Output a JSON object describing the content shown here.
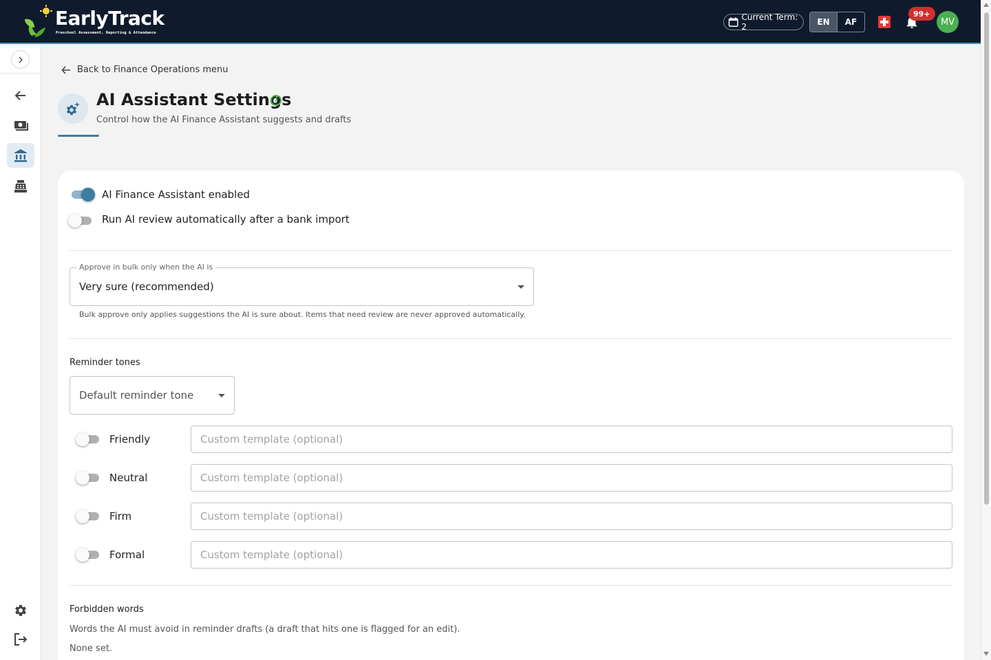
{
  "app": {
    "name": "EarlyTrack",
    "tagline": "Preschool Assessment, Reporting & Attendance"
  },
  "topbar": {
    "term_label": "Current Term: 2",
    "languages": [
      "EN",
      "AF"
    ],
    "active_language": "EN",
    "notification_count": "99+",
    "user_initials": "MV",
    "colors": {
      "bar": "#0f1b2d",
      "badge": "#d32f2f",
      "avatar": "#4caf50"
    }
  },
  "sidebar": {
    "items": [
      {
        "icon": "arrow-left-icon"
      },
      {
        "icon": "cash-icon"
      },
      {
        "icon": "bank-icon",
        "active": true
      },
      {
        "icon": "cash-register-icon"
      }
    ],
    "bottom": [
      {
        "icon": "gear-icon"
      },
      {
        "icon": "logout-icon"
      }
    ]
  },
  "page": {
    "back_link": "Back to Finance Operations menu",
    "title": "AI Assistant Settings",
    "subtitle": "Control how the AI Finance Assistant suggests and drafts"
  },
  "settings": {
    "ai_enabled_label": "AI Finance Assistant enabled",
    "ai_enabled": true,
    "auto_review_label": "Run AI review automatically after a bank import",
    "auto_review": false,
    "bulk_approve": {
      "legend": "Approve in bulk only when the AI is",
      "value": "Very sure (recommended)",
      "helper": "Bulk approve only applies suggestions the AI is sure about. Items that need review are never approved automatically."
    },
    "reminder_tones": {
      "title": "Reminder tones",
      "default_select": "Default reminder tone",
      "template_placeholder": "Custom template (optional)",
      "tones": [
        {
          "label": "Friendly",
          "enabled": false
        },
        {
          "label": "Neutral",
          "enabled": false
        },
        {
          "label": "Firm",
          "enabled": false
        },
        {
          "label": "Formal",
          "enabled": false
        }
      ]
    },
    "forbidden_words": {
      "title": "Forbidden words",
      "description": "Words the AI must avoid in reminder drafts (a draft that hits one is flagged for an edit).",
      "empty": "None set."
    }
  }
}
